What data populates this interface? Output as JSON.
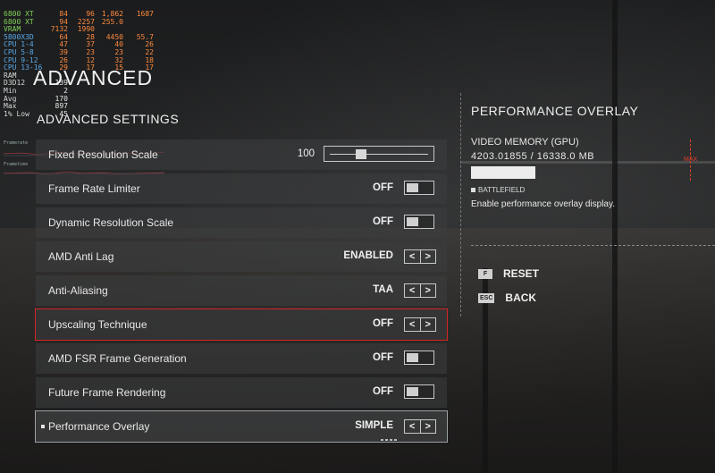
{
  "hud": {
    "rows": [
      {
        "name": "6800 XT",
        "c1": "84",
        "c2": "96",
        "c3": "1,862",
        "c4": "1687"
      },
      {
        "name": "6800 XT",
        "c1": "94",
        "c2": "2257",
        "c3": "255.0",
        "c4": ""
      },
      {
        "name": "VRAM",
        "c1": "7132",
        "c2": "1990",
        "c3": "",
        "c4": ""
      },
      {
        "name": "5800X3D",
        "c1": "64",
        "c2": "28",
        "c3": "4450",
        "c4": "55.7"
      },
      {
        "name": "CPU 1-4",
        "c1": "47",
        "c2": "37",
        "c3": "40",
        "c4": "26"
      },
      {
        "name": "CPU 5-8",
        "c1": "39",
        "c2": "23",
        "c3": "23",
        "c4": "22"
      },
      {
        "name": "CPU 9-12",
        "c1": "26",
        "c2": "12",
        "c3": "32",
        "c4": "18"
      },
      {
        "name": "CPU 13-16",
        "c1": "29",
        "c2": "17",
        "c3": "15",
        "c4": "17"
      },
      {
        "name": "RAM",
        "c1": "",
        "c2": "",
        "c3": "",
        "c4": ""
      },
      {
        "name": "D3D12",
        "c1": "139",
        "c2": "",
        "c3": "",
        "c4": ""
      },
      {
        "name": "Min",
        "c1": "2",
        "c2": "",
        "c3": "",
        "c4": ""
      },
      {
        "name": "Avg",
        "c1": "170",
        "c2": "",
        "c3": "",
        "c4": ""
      },
      {
        "name": "Max",
        "c1": "897",
        "c2": "",
        "c3": "",
        "c4": ""
      },
      {
        "name": "1% Low",
        "c1": "45",
        "c2": "",
        "c3": "",
        "c4": ""
      }
    ],
    "graph1_label": "Framerate",
    "graph2_label": "Frametime"
  },
  "page_title": "ADVANCED",
  "section_title": "ADVANCED SETTINGS",
  "settings": [
    {
      "label": "Fixed Resolution Scale",
      "value": "100",
      "control": "slider",
      "slider_fraction": 0.3
    },
    {
      "label": "Frame Rate Limiter",
      "value": "OFF",
      "control": "toggle"
    },
    {
      "label": "Dynamic Resolution Scale",
      "value": "OFF",
      "control": "toggle"
    },
    {
      "label": "AMD Anti Lag",
      "value": "ENABLED",
      "control": "arrows"
    },
    {
      "label": "Anti-Aliasing",
      "value": "TAA",
      "control": "arrows"
    },
    {
      "label": "Upscaling Technique",
      "value": "OFF",
      "control": "arrows",
      "state": "focused"
    },
    {
      "label": "AMD FSR Frame Generation",
      "value": "OFF",
      "control": "toggle"
    },
    {
      "label": "Future Frame Rendering",
      "value": "OFF",
      "control": "toggle"
    },
    {
      "label": "Performance Overlay",
      "value": "SIMPLE",
      "control": "arrows",
      "state": "selected"
    }
  ],
  "arrows": {
    "left": "<",
    "right": ">"
  },
  "panel": {
    "title": "PERFORMANCE OVERLAY",
    "vram_label": "VIDEO MEMORY (GPU)",
    "vram_value": "4203.01855 / 16338.0 MB",
    "vram_fraction": 0.257,
    "max_label": "MAX",
    "game_tag": "BATTLEFIELD",
    "description": "Enable performance overlay display."
  },
  "actions": [
    {
      "key": "F",
      "label": "RESET"
    },
    {
      "key": "ESC",
      "label": "BACK"
    }
  ],
  "colors": {
    "focus_border": "#d62424",
    "hud_value": "#ff8a3d",
    "max_marker": "#e0402a"
  }
}
